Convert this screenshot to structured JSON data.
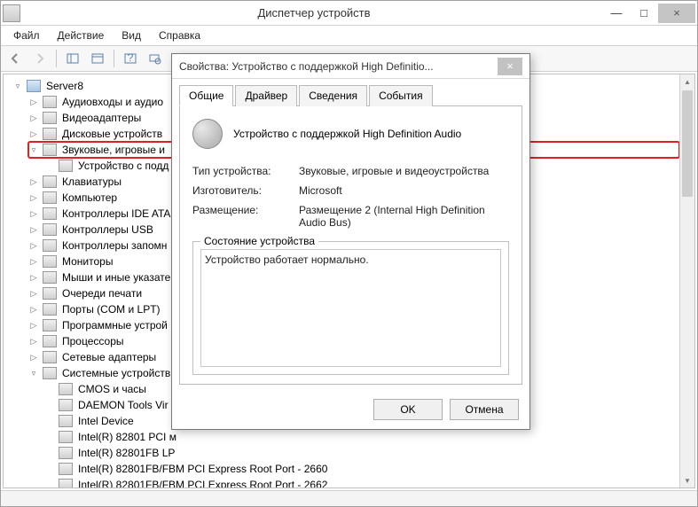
{
  "window": {
    "title": "Диспетчер устройств",
    "minimize": "—",
    "maximize": "□",
    "close": "×"
  },
  "menu": {
    "file": "Файл",
    "action": "Действие",
    "view": "Вид",
    "help": "Справка"
  },
  "tree": {
    "root": "Server8",
    "items": [
      {
        "label": "Аудиовходы и аудио",
        "expander": "▷"
      },
      {
        "label": "Видеоадаптеры",
        "expander": "▷"
      },
      {
        "label": "Дисковые устройств",
        "expander": "▷"
      },
      {
        "label": "Звуковые, игровые и",
        "expander": "▿",
        "highlight": true,
        "children": [
          {
            "label": "Устройство с подд"
          }
        ]
      },
      {
        "label": "Клавиатуры",
        "expander": "▷"
      },
      {
        "label": "Компьютер",
        "expander": "▷"
      },
      {
        "label": "Контроллеры IDE ATA",
        "expander": "▷"
      },
      {
        "label": "Контроллеры USB",
        "expander": "▷"
      },
      {
        "label": "Контроллеры запомн",
        "expander": "▷"
      },
      {
        "label": "Мониторы",
        "expander": "▷"
      },
      {
        "label": "Мыши и иные указате",
        "expander": "▷"
      },
      {
        "label": "Очереди печати",
        "expander": "▷"
      },
      {
        "label": "Порты (COM и LPT)",
        "expander": "▷"
      },
      {
        "label": "Программные устрой",
        "expander": "▷"
      },
      {
        "label": "Процессоры",
        "expander": "▷"
      },
      {
        "label": "Сетевые адаптеры",
        "expander": "▷"
      },
      {
        "label": "Системные устройств",
        "expander": "▿",
        "children": [
          {
            "label": "CMOS и часы"
          },
          {
            "label": "DAEMON Tools Vir"
          },
          {
            "label": "Intel Device"
          },
          {
            "label": "Intel(R) 82801 PCI м"
          },
          {
            "label": "Intel(R) 82801FB LP"
          },
          {
            "label": "Intel(R) 82801FB/FBM PCI Express Root Port - 2660"
          },
          {
            "label": "Intel(R) 82801FB/FBM PCI Express Root Port - 2662"
          }
        ]
      }
    ]
  },
  "dialog": {
    "title": "Свойства: Устройство с поддержкой High Definitio...",
    "close": "×",
    "tabs": {
      "general": "Общие",
      "driver": "Драйвер",
      "details": "Сведения",
      "events": "События"
    },
    "device_name": "Устройство с поддержкой High Definition Audio",
    "props": {
      "type_label": "Тип устройства:",
      "type_value": "Звуковые, игровые и видеоустройства",
      "mfr_label": "Изготовитель:",
      "mfr_value": "Microsoft",
      "loc_label": "Размещение:",
      "loc_value": "Размещение 2 (Internal High Definition Audio Bus)"
    },
    "status_legend": "Состояние устройства",
    "status_text": "Устройство работает нормально.",
    "ok": "OK",
    "cancel": "Отмена"
  }
}
